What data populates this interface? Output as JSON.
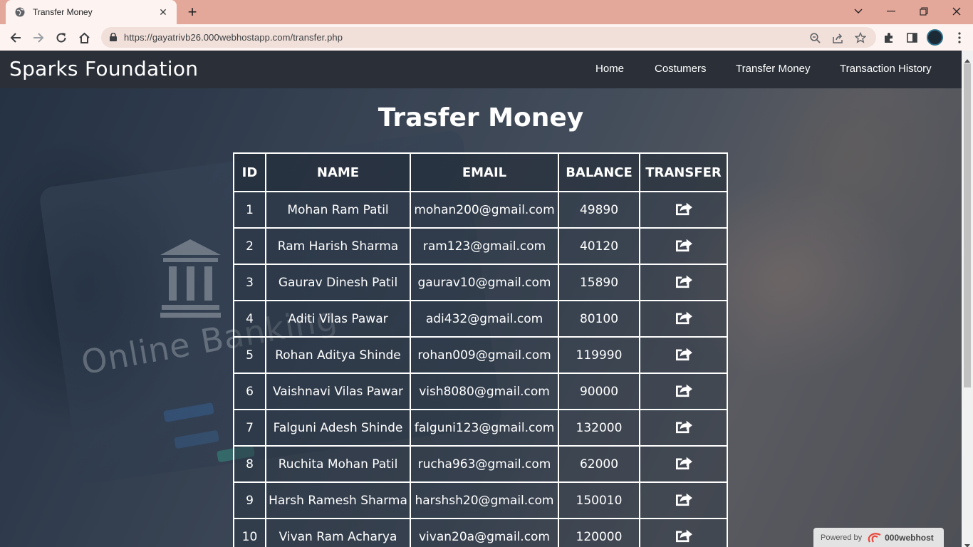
{
  "browser": {
    "tab_title": "Transfer Money",
    "url": "https://gayatrivb26.000webhostapp.com/transfer.php"
  },
  "navbar": {
    "brand": "Sparks Foundation",
    "links": [
      "Home",
      "Costumers",
      "Transfer Money",
      "Transaction History"
    ]
  },
  "page": {
    "title": "Trasfer Money",
    "background_text": "Online Banking"
  },
  "table": {
    "headers": [
      "ID",
      "NAME",
      "EMAIL",
      "BALANCE",
      "TRANSFER"
    ],
    "rows": [
      {
        "id": "1",
        "name": "Mohan Ram Patil",
        "email": "mohan200@gmail.com",
        "balance": "49890"
      },
      {
        "id": "2",
        "name": "Ram Harish Sharma",
        "email": "ram123@gmail.com",
        "balance": "40120"
      },
      {
        "id": "3",
        "name": "Gaurav Dinesh Patil",
        "email": "gaurav10@gmail.com",
        "balance": "15890"
      },
      {
        "id": "4",
        "name": "Aditi Vilas Pawar",
        "email": "adi432@gmail.com",
        "balance": "80100"
      },
      {
        "id": "5",
        "name": "Rohan Aditya Shinde",
        "email": "rohan009@gmail.com",
        "balance": "119990"
      },
      {
        "id": "6",
        "name": "Vaishnavi Vilas Pawar",
        "email": "vish8080@gmail.com",
        "balance": "90000"
      },
      {
        "id": "7",
        "name": "Falguni Adesh Shinde",
        "email": "falguni123@gmail.com",
        "balance": "132000"
      },
      {
        "id": "8",
        "name": "Ruchita Mohan Patil",
        "email": "rucha963@gmail.com",
        "balance": "62000"
      },
      {
        "id": "9",
        "name": "Harsh Ramesh Sharma",
        "email": "harshsh20@gmail.com",
        "balance": "150010"
      },
      {
        "id": "10",
        "name": "Vivan Ram Acharya",
        "email": "vivan20a@gmail.com",
        "balance": "120000"
      }
    ]
  },
  "footer_badge": {
    "prefix": "Powered by",
    "brand": "000webhost"
  },
  "colors": {
    "tabstrip": "#e4a89a",
    "toolbar": "#fdf3f1",
    "navbar": "#2b3038"
  }
}
